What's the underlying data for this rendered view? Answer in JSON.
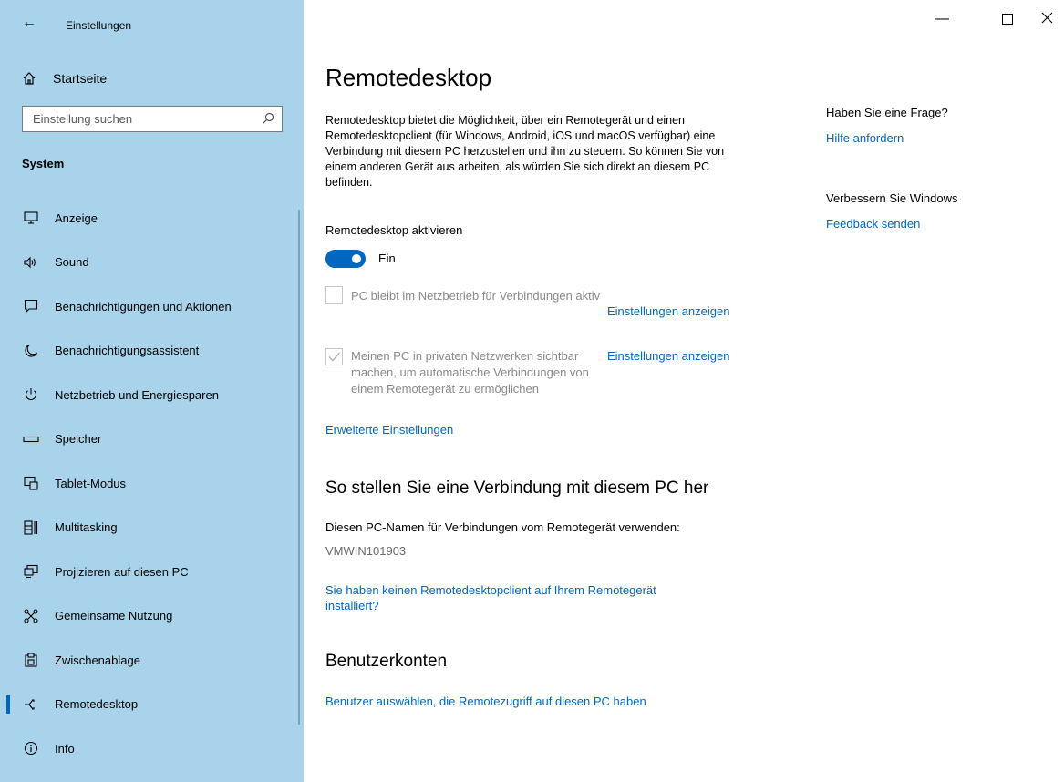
{
  "window": {
    "title": "Einstellungen",
    "controls": [
      "minimize",
      "maximize",
      "close"
    ]
  },
  "sidebar": {
    "home_label": "Startseite",
    "search_placeholder": "Einstellung suchen",
    "section_title": "System",
    "items": [
      {
        "label": "Anzeige",
        "icon": "monitor-icon"
      },
      {
        "label": "Sound",
        "icon": "speaker-icon"
      },
      {
        "label": "Benachrichtigungen und Aktionen",
        "icon": "notification-icon"
      },
      {
        "label": "Benachrichtigungsassistent",
        "icon": "moon-icon"
      },
      {
        "label": "Netzbetrieb und Energiesparen",
        "icon": "power-icon"
      },
      {
        "label": "Speicher",
        "icon": "storage-icon"
      },
      {
        "label": "Tablet-Modus",
        "icon": "tablet-mode-icon"
      },
      {
        "label": "Multitasking",
        "icon": "multitasking-icon"
      },
      {
        "label": "Projizieren auf diesen PC",
        "icon": "project-icon"
      },
      {
        "label": "Gemeinsame Nutzung",
        "icon": "share-icon"
      },
      {
        "label": "Zwischenablage",
        "icon": "clipboard-icon"
      },
      {
        "label": "Remotedesktop",
        "icon": "remote-desktop-icon",
        "active": true
      },
      {
        "label": "Info",
        "icon": "info-icon"
      }
    ]
  },
  "main": {
    "title": "Remotedesktop",
    "description": "Remotedesktop bietet die Möglichkeit, über ein Remotegerät und einen Remotedesktopclient (für Windows, Android, iOS und macOS verfügbar) eine Verbindung mit diesem PC herzustellen und ihn zu steuern. So können Sie von einem anderen Gerät aus arbeiten, als würden Sie sich direkt an diesem PC befinden.",
    "enable_label": "Remotedesktop aktivieren",
    "toggle_state": "Ein",
    "toggle_on": true,
    "checkbox1": {
      "label": "PC bleibt im Netzbetrieb für Verbindungen aktiv",
      "checked": false,
      "link": "Einstellungen anzeigen"
    },
    "checkbox2": {
      "label": "Meinen PC in privaten Netzwerken sichtbar machen, um automatische Verbindungen von einem Remotegerät zu ermöglichen",
      "checked": true,
      "link": "Einstellungen anzeigen"
    },
    "advanced_link": "Erweiterte Einstellungen",
    "connect_heading": "So stellen Sie eine Verbindung mit diesem PC her",
    "pc_name_label": "Diesen PC-Namen für Verbindungen vom Remotegerät verwenden:",
    "pc_name": "VMWIN101903",
    "no_client_link": "Sie haben keinen Remotedesktopclient auf Ihrem Remotegerät installiert?",
    "accounts_heading": "Benutzerkonten",
    "accounts_link": "Benutzer auswählen, die Remotezugriff auf diesen PC haben"
  },
  "right_panel": {
    "question": "Haben Sie eine Frage?",
    "help_link": "Hilfe anfordern",
    "improve": "Verbessern Sie Windows",
    "feedback_link": "Feedback senden"
  }
}
